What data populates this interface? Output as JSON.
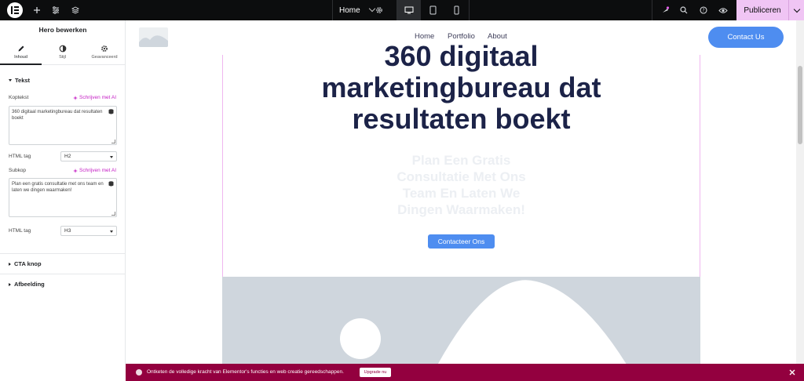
{
  "topbar": {
    "page_name": "Home",
    "publish_label": "Publiceren",
    "icons": [
      "elementor-logo-icon",
      "add-icon",
      "site-settings-icon",
      "structure-icon",
      "page-settings-icon",
      "desktop-icon",
      "tablet-icon",
      "mobile-icon",
      "whats-new-icon",
      "search-icon",
      "help-icon",
      "preview-icon"
    ],
    "accent": "#f0c5f4"
  },
  "panel": {
    "title": "Hero bewerken",
    "tabs": [
      {
        "label": "Inhoud",
        "icon": "pencil-icon"
      },
      {
        "label": "Stijl",
        "icon": "contrast-icon"
      },
      {
        "label": "Geavanceerd",
        "icon": "gear-icon"
      }
    ],
    "section_text": "Tekst",
    "heading_label": "Koptekst",
    "ai_label": "Schrijven met AI",
    "heading_value": "360 digitaal marketingbureau dat resultaten boekt",
    "html_tag_label": "HTML tag",
    "heading_tag": "H2",
    "subhead_label": "Subkop",
    "subhead_value": "Plan een gratis consultatie met ons team en laten we dingen waarmaken!",
    "subhead_tag": "H3",
    "section_cta": "CTA knop",
    "section_image": "Afbeelding"
  },
  "canvas": {
    "nav": [
      "Home",
      "Portfolio",
      "About"
    ],
    "contact_label": "Contact Us",
    "heading": "360 digitaal\nmarketingbureau dat\nresultaten boekt",
    "subheading": "Plan Een Gratis\nConsultatie Met Ons\nTeam En Laten We\nDingen Waarmaken!",
    "cta_label": "Contacteer Ons",
    "brand_color": "#4e8df0"
  },
  "promo": {
    "text": "Ontketen de volledige kracht van Elementor's functies en web creatie gereedschappen.",
    "upgrade_label": "Upgrade nu",
    "color": "#93003f"
  }
}
